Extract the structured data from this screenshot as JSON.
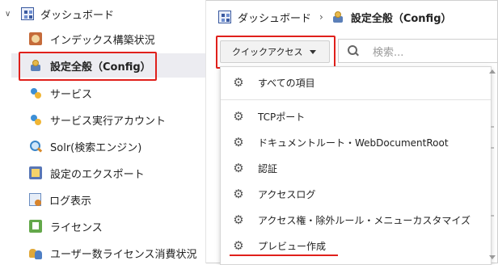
{
  "sidebar": {
    "root": {
      "label": "ダッシュボード",
      "icon": "dashboard-icon"
    },
    "items": [
      {
        "label": "インデックス構築状況",
        "icon": "index-build-icon"
      },
      {
        "label": "設定全般（Config）",
        "icon": "config-icon",
        "selected": true
      },
      {
        "label": "サービス",
        "icon": "service-icon"
      },
      {
        "label": "サービス実行アカウント",
        "icon": "service-account-icon"
      },
      {
        "label": "Solr(検索エンジン)",
        "icon": "solr-search-icon"
      },
      {
        "label": "設定のエクスポート",
        "icon": "export-icon"
      },
      {
        "label": "ログ表示",
        "icon": "log-icon"
      },
      {
        "label": "ライセンス",
        "icon": "license-icon"
      },
      {
        "label": "ユーザー数ライセンス消費状況",
        "icon": "user-license-icon"
      }
    ]
  },
  "breadcrumb": {
    "root": "ダッシュボード",
    "separator": "›",
    "current": "設定全般（Config）"
  },
  "toolbar": {
    "quick_access_label": "クイックアクセス",
    "search_placeholder": "検索..."
  },
  "quick_access_menu": [
    "すべての項目",
    "TCPポート",
    "ドキュメントルート・WebDocumentRoot",
    "認証",
    "アクセスログ",
    "アクセス権・除外ルール・メニューカスタマイズ",
    "プレビュー作成"
  ],
  "colors": {
    "highlight": "#e0201b",
    "selected_bg": "#ececf1"
  }
}
